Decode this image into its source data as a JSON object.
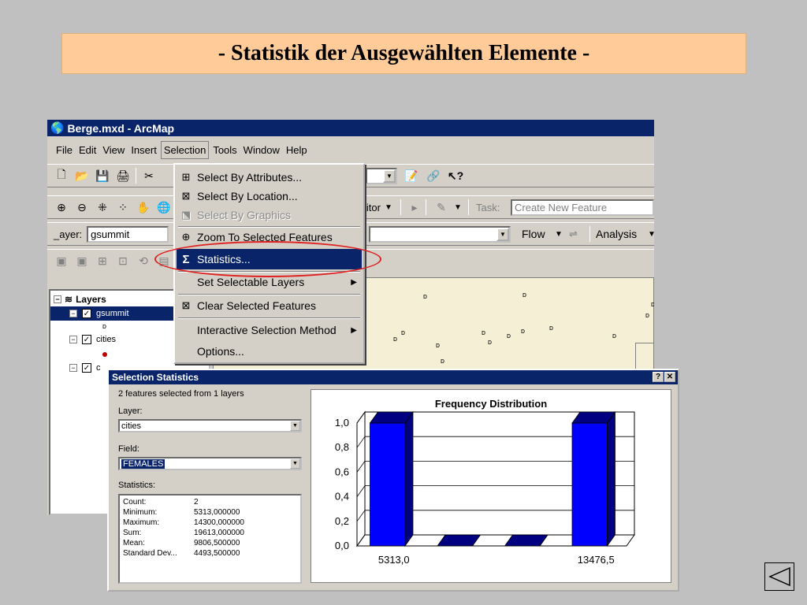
{
  "slide_title": "- Statistik der Ausgewählten Elemente -",
  "window": {
    "title": "Berge.mxd - ArcMap",
    "icon": "globe-icon"
  },
  "menubar": {
    "items": [
      "File",
      "Edit",
      "View",
      "Insert",
      "Selection",
      "Tools",
      "Window",
      "Help"
    ],
    "active": "Selection"
  },
  "toolbar2": {
    "editor_label": "litor",
    "task_label": "Task:",
    "task_value": "Create New Feature"
  },
  "toolbar3": {
    "layer_label": "_ayer:",
    "layer_value": "gsummit",
    "flow_label": "Flow",
    "analysis_label": "Analysis"
  },
  "toc": {
    "root": "Layers",
    "layers": [
      "gsummit",
      "cities",
      "c"
    ]
  },
  "selection_menu": {
    "items": [
      {
        "label": "Select By Attributes...",
        "icon": "table-select-icon",
        "state": "enabled"
      },
      {
        "label": "Select By Location...",
        "icon": "location-select-icon",
        "state": "enabled"
      },
      {
        "label": "Select By Graphics",
        "icon": "graphics-select-icon",
        "state": "disabled"
      },
      {
        "label": "Zoom To Selected Features",
        "icon": "zoom-selected-icon",
        "state": "enabled"
      },
      {
        "label": "Statistics...",
        "icon": "sigma-icon",
        "state": "highlighted"
      },
      {
        "label": "Set Selectable Layers",
        "icon": "",
        "state": "submenu"
      },
      {
        "label": "Clear Selected Features",
        "icon": "clear-selection-icon",
        "state": "enabled"
      },
      {
        "label": "Interactive Selection Method",
        "icon": "",
        "state": "submenu"
      },
      {
        "label": "Options...",
        "icon": "",
        "state": "enabled"
      }
    ]
  },
  "dialog": {
    "title": "Selection Statistics",
    "summary": "2 features selected from 1 layers",
    "layer_label": "Layer:",
    "layer_value": "cities",
    "field_label": "Field:",
    "field_value": "FEMALES",
    "stats_label": "Statistics:",
    "stats": [
      {
        "name": "Count:",
        "value": "2"
      },
      {
        "name": "Minimum:",
        "value": "5313,000000"
      },
      {
        "name": "Maximum:",
        "value": "14300,000000"
      },
      {
        "name": "Sum:",
        "value": "19613,000000"
      },
      {
        "name": "Mean:",
        "value": "9806,500000"
      },
      {
        "name": "Standard Dev...",
        "value": "4493,500000"
      }
    ],
    "help_btn": "?",
    "close_btn": "✕"
  },
  "chart_data": {
    "type": "bar",
    "title": "Frequency Distribution",
    "categories": [
      "5313,0",
      "",
      "",
      "13476,5"
    ],
    "values": [
      1.0,
      0.0,
      0.0,
      1.0
    ],
    "ylim": [
      0,
      1
    ],
    "yticks": [
      "0,0",
      "0,2",
      "0,4",
      "0,6",
      "0,8",
      "1,0"
    ],
    "grid": true,
    "bar_color": "#0000ff",
    "bar_side_color": "#000080"
  },
  "colors": {
    "highlight": "#0a246a",
    "banner": "#ffcc99",
    "ellipse": "#e02020",
    "map_bg": "#f5f0d5"
  }
}
